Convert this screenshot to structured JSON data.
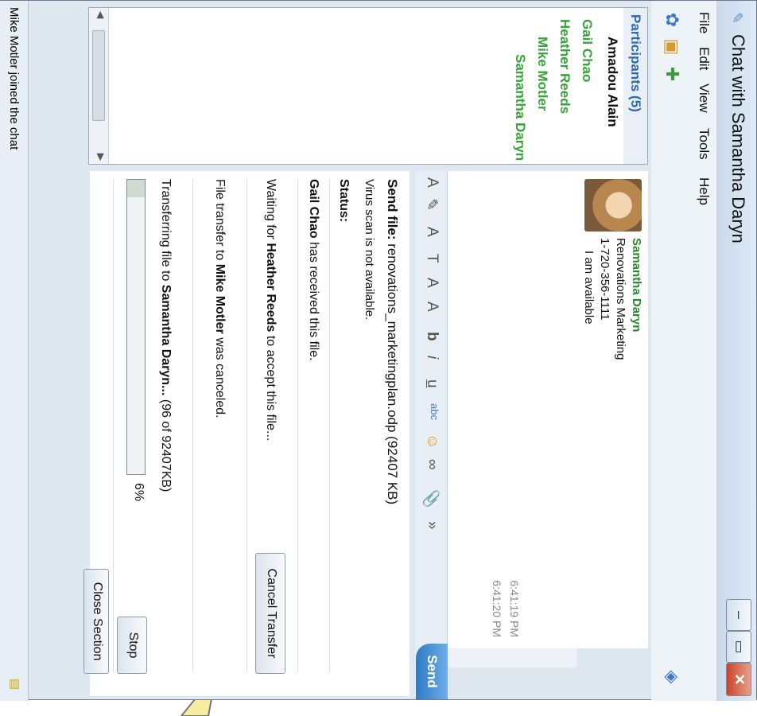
{
  "window": {
    "title": "Chat with Samantha Daryn",
    "min_glyph": "–",
    "max_glyph": "▭",
    "close_glyph": "✕"
  },
  "menu": [
    "File",
    "Edit",
    "View",
    "Tools",
    "Help"
  ],
  "toolbar_icons": [
    "group-icon",
    "contacts-icon",
    "add-participant-icon"
  ],
  "participants": {
    "header": "Participants (5)",
    "items": [
      {
        "name": "Amadou Alain",
        "color": "#111111"
      },
      {
        "name": "Gail Chao",
        "color": "#36a436"
      },
      {
        "name": "Heather Reeds",
        "color": "#36a436"
      },
      {
        "name": "Mike Motler",
        "color": "#36a436"
      },
      {
        "name": "Samantha Daryn",
        "color": "#36a436"
      }
    ]
  },
  "contact": {
    "name": "Samantha Daryn",
    "company": "Renovations Marketing",
    "phone": "1-720-356-1111",
    "status": "I am available"
  },
  "history": {
    "times": [
      "6:41:19 PM",
      "6:41:20 PM"
    ]
  },
  "format_bar": {
    "buttons": [
      "A",
      "✎",
      "A",
      "T",
      "A",
      "A",
      "b",
      "i",
      "u",
      "abc",
      "☺",
      "∞",
      "📎",
      "»"
    ],
    "send_label": "Send"
  },
  "transfer": {
    "send_file_label": "Send file:",
    "file_name": "renovations_marketingplan.odp (92407 KB)",
    "virus_scan": "Virus scan is not available.",
    "status_label": "Status:",
    "received_name": "Gail Chao",
    "received_text": "has received this file.",
    "waiting_prefix": "Waiting for",
    "waiting_name": "Heather Reeds",
    "waiting_suffix": "to accept this file...",
    "cancel_button": "Cancel Transfer",
    "canceled_prefix": "File transfer to",
    "canceled_name": "Mike Motler",
    "canceled_suffix": "was canceled.",
    "transferring_prefix": "Transferring file to",
    "transferring_name": "Samantha Daryn...",
    "transferring_suffix": "(96 of 92407KB)",
    "progress_percent": 6,
    "progress_label": "6%",
    "stop_button": "Stop",
    "close_section_button": "Close Section"
  },
  "statusbar": {
    "text": "Mike Motler joined the chat"
  },
  "colors": {
    "accent": "#2d67b5",
    "online": "#36a436",
    "callout": "#f5eea0"
  }
}
